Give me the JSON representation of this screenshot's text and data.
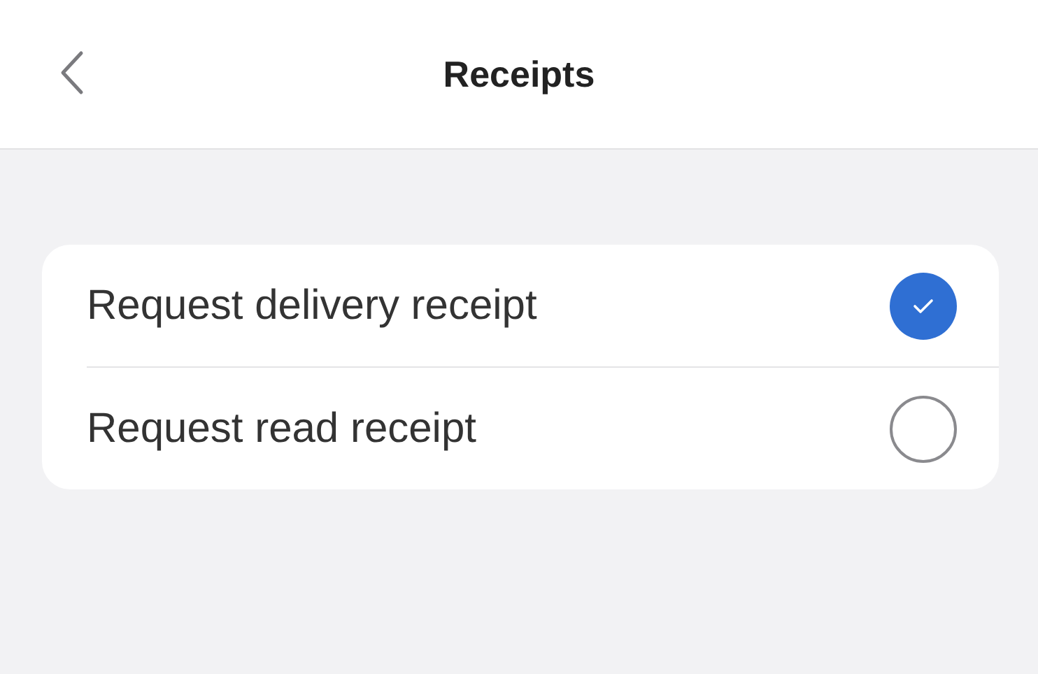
{
  "header": {
    "title": "Receipts"
  },
  "options": [
    {
      "label": "Request delivery receipt",
      "checked": true
    },
    {
      "label": "Request read receipt",
      "checked": false
    }
  ]
}
